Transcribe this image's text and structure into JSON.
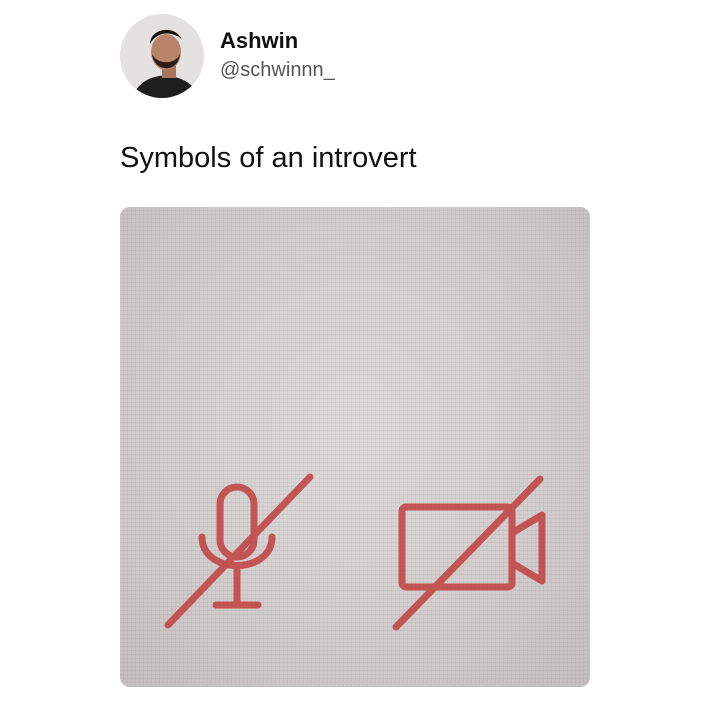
{
  "tweet": {
    "author_name": "Ashwin",
    "author_handle": "@schwinnn_",
    "text": "Symbols of an introvert"
  },
  "photo": {
    "icons": [
      {
        "name": "microphone-muted-icon",
        "state": "muted"
      },
      {
        "name": "camera-off-icon",
        "state": "off"
      }
    ],
    "icon_color": "#c0413f"
  },
  "colors": {
    "background": "#ffffff",
    "text": "#111111",
    "handle": "#555555",
    "screen": "#ccc6c6"
  }
}
